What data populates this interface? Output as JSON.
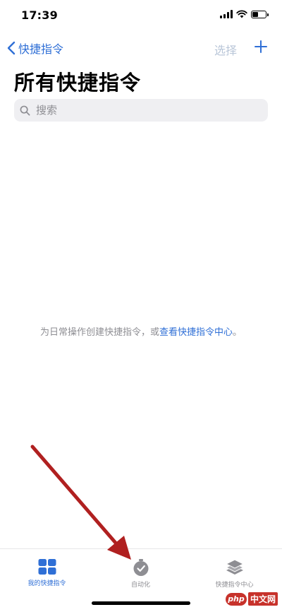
{
  "status_bar": {
    "time": "17:39",
    "battery_level": 0.45
  },
  "nav": {
    "back_label": "快捷指令",
    "select_label": "选择"
  },
  "page": {
    "title": "所有快捷指令"
  },
  "search": {
    "placeholder": "搜索",
    "value": ""
  },
  "empty_state": {
    "prefix": "为日常操作创建快捷指令，或",
    "link": "查看快捷指令中心",
    "suffix": "。"
  },
  "tab_bar": {
    "tabs": [
      {
        "label": "我的快捷指令",
        "icon": "grid-icon",
        "active": true
      },
      {
        "label": "自动化",
        "icon": "clock-check-icon",
        "active": false
      },
      {
        "label": "快捷指令中心",
        "icon": "layers-icon",
        "active": false
      }
    ]
  },
  "watermark": {
    "logo": "php",
    "text": "中文网"
  },
  "colors": {
    "accent": "#2f6fd6",
    "disabled": "#b9c6d8",
    "annotation_arrow": "#b02020",
    "tab_inactive": "#8e8e93"
  }
}
